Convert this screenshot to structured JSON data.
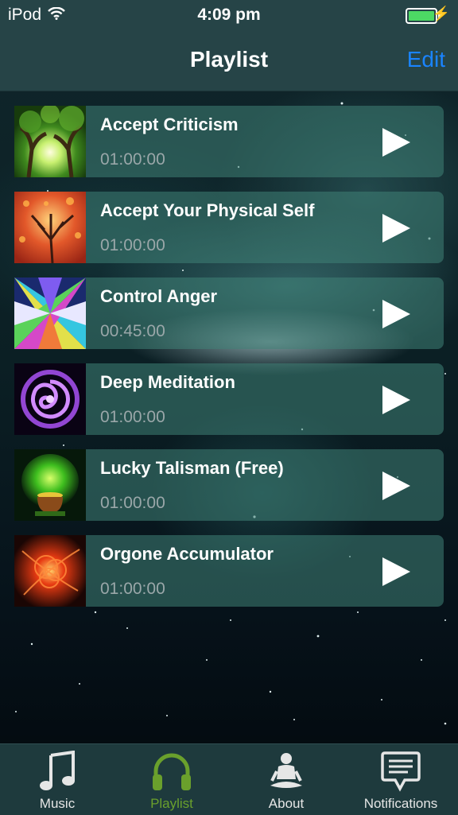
{
  "status_bar": {
    "carrier": "iPod",
    "time": "4:09 pm"
  },
  "nav": {
    "title": "Playlist",
    "edit_label": "Edit"
  },
  "playlist": [
    {
      "title": "Accept Criticism",
      "duration": "01:00:00"
    },
    {
      "title": "Accept Your Physical Self",
      "duration": "01:00:00"
    },
    {
      "title": "Control Anger",
      "duration": "00:45:00"
    },
    {
      "title": "Deep Meditation",
      "duration": "01:00:00"
    },
    {
      "title": "Lucky Talisman (Free)",
      "duration": "01:00:00"
    },
    {
      "title": "Orgone Accumulator",
      "duration": "01:00:00"
    }
  ],
  "tabs": [
    {
      "label": "Music",
      "icon": "music-note-icon"
    },
    {
      "label": "Playlist",
      "icon": "headphones-icon",
      "active": true
    },
    {
      "label": "About",
      "icon": "meditation-icon"
    },
    {
      "label": "Notifications",
      "icon": "speech-bubble-icon"
    }
  ],
  "colors": {
    "accent": "#1a84ff",
    "active_tab": "#6aa02c",
    "battery": "#4cd964"
  }
}
